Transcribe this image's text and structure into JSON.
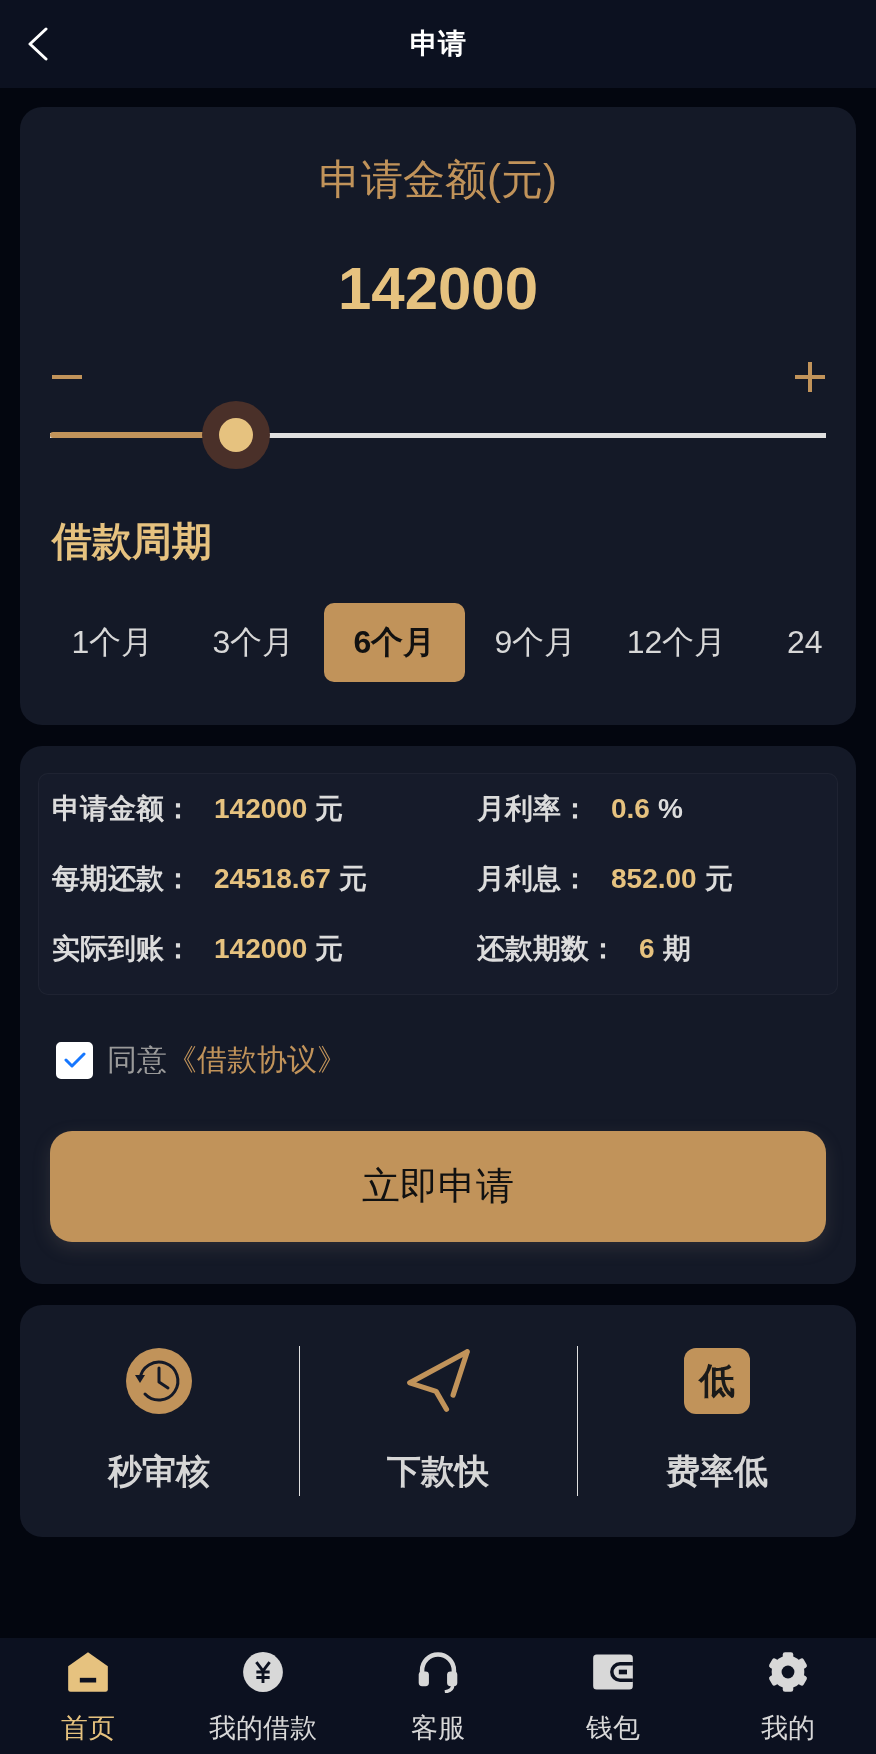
{
  "header": {
    "title": "申请"
  },
  "amount": {
    "label": "申请金额(元)",
    "value": "142000",
    "level": 0.24
  },
  "period": {
    "title": "借款周期",
    "options": [
      {
        "label": "1个月",
        "selected": false
      },
      {
        "label": "3个月",
        "selected": false
      },
      {
        "label": "6个月",
        "selected": true
      },
      {
        "label": "9个月",
        "selected": false
      },
      {
        "label": "12个月",
        "selected": false
      },
      {
        "label": "24",
        "selected": false
      }
    ]
  },
  "summary": {
    "items": [
      {
        "label": "申请金额：",
        "value": "142000",
        "unit": "元"
      },
      {
        "label": "月利率：",
        "value": "0.6",
        "unit": "%"
      },
      {
        "label": "每期还款：",
        "value": "24518.67",
        "unit": "元"
      },
      {
        "label": "月利息：",
        "value": "852.00",
        "unit": "元"
      },
      {
        "label": "实际到账：",
        "value": "142000",
        "unit": "元"
      },
      {
        "label": "还款期数：",
        "value": "6",
        "unit": "期"
      }
    ]
  },
  "agreement": {
    "checked": true,
    "text": "同意",
    "link": "《借款协议》"
  },
  "submit": {
    "label": "立即申请"
  },
  "features": [
    {
      "kind": "clock",
      "label": "秒审核"
    },
    {
      "kind": "plane",
      "label": "下款快"
    },
    {
      "kind": "badge",
      "badge": "低",
      "label": "费率低"
    }
  ],
  "tabbar": [
    {
      "kind": "home",
      "label": "首页",
      "selected": true
    },
    {
      "kind": "yen",
      "label": "我的借款",
      "selected": false
    },
    {
      "kind": "headset",
      "label": "客服",
      "selected": false
    },
    {
      "kind": "wallet",
      "label": "钱包",
      "selected": false
    },
    {
      "kind": "gear",
      "label": "我的",
      "selected": false
    }
  ]
}
